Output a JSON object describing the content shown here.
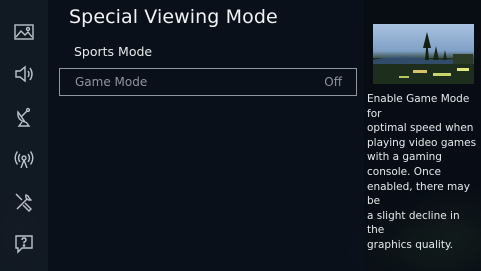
{
  "header": {
    "title": "Special Viewing Mode"
  },
  "menu": {
    "sports_mode": "Sports Mode",
    "game_mode": {
      "label": "Game Mode",
      "value": "Off"
    }
  },
  "sidebar": {
    "items": [
      {
        "icon": "picture-icon"
      },
      {
        "icon": "sound-icon"
      },
      {
        "icon": "broadcasting-icon"
      },
      {
        "icon": "network-icon"
      },
      {
        "icon": "system-icon"
      },
      {
        "icon": "support-icon"
      }
    ]
  },
  "info": {
    "thumbnail_icon": "gamepad-icon",
    "description": "Enable Game Mode for\noptimal speed when\nplaying video games\nwith a gaming\nconsole. Once\nenabled, there may be\na slight decline in the\ngraphics quality."
  }
}
